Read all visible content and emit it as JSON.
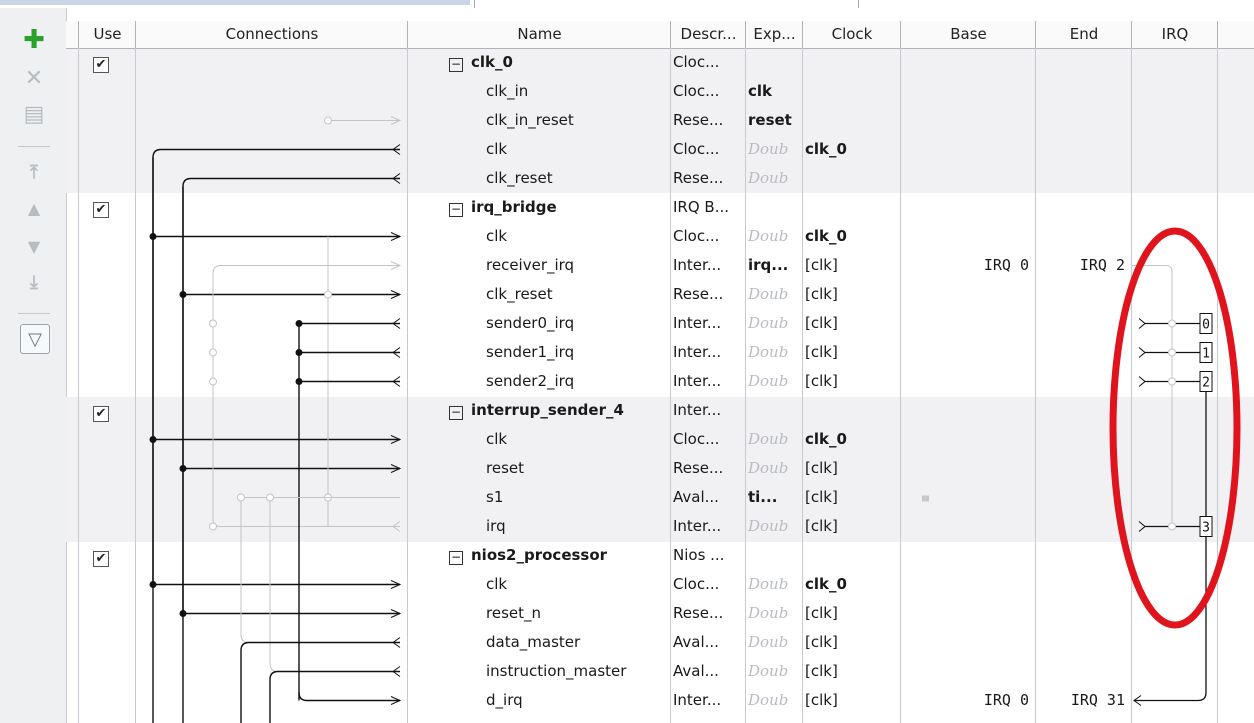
{
  "toolbar": {
    "add": "✚",
    "remove": "✕",
    "edit": "▤",
    "move_top": "⤒",
    "move_up": "▲",
    "move_down": "▼",
    "move_bottom": "⤓",
    "filter": "▽"
  },
  "columns": {
    "use": "Use",
    "connections": "Connections",
    "name": "Name",
    "description": "Descr...",
    "export": "Exp...",
    "clock": "Clock",
    "base": "Base",
    "end": "End",
    "irq": "IRQ"
  },
  "checked_glyph": "✔",
  "collapse_glyph": "−",
  "rows": [
    {
      "name": "clk_0",
      "descr": "Cloc...",
      "exp": "",
      "clock": "",
      "base": "",
      "end": ""
    },
    {
      "name": "clk_in",
      "descr": "Cloc...",
      "exp": "clk",
      "clock": "",
      "base": "",
      "end": ""
    },
    {
      "name": "clk_in_reset",
      "descr": "Rese...",
      "exp": "reset",
      "clock": "",
      "base": "",
      "end": ""
    },
    {
      "name": "clk",
      "descr": "Cloc...",
      "exp": "Doub",
      "clock": "clk_0",
      "base": "",
      "end": ""
    },
    {
      "name": "clk_reset",
      "descr": "Rese...",
      "exp": "Doub",
      "clock": "",
      "base": "",
      "end": ""
    },
    {
      "name": "irq_bridge",
      "descr": "IRQ B...",
      "exp": "",
      "clock": "",
      "base": "",
      "end": ""
    },
    {
      "name": "clk",
      "descr": "Cloc...",
      "exp": "Doub",
      "clock": "clk_0",
      "base": "",
      "end": ""
    },
    {
      "name": "receiver_irq",
      "descr": "Inter...",
      "exp": "irq...",
      "clock": "[clk]",
      "base": "IRQ 0",
      "end": "IRQ 2"
    },
    {
      "name": "clk_reset",
      "descr": "Rese...",
      "exp": "Doub",
      "clock": "[clk]",
      "base": "",
      "end": ""
    },
    {
      "name": "sender0_irq",
      "descr": "Inter...",
      "exp": "Doub",
      "clock": "[clk]",
      "base": "",
      "end": ""
    },
    {
      "name": "sender1_irq",
      "descr": "Inter...",
      "exp": "Doub",
      "clock": "[clk]",
      "base": "",
      "end": ""
    },
    {
      "name": "sender2_irq",
      "descr": "Inter...",
      "exp": "Doub",
      "clock": "[clk]",
      "base": "",
      "end": ""
    },
    {
      "name": "interrup_sender_4",
      "descr": "Inter...",
      "exp": "",
      "clock": "",
      "base": "",
      "end": ""
    },
    {
      "name": "clk",
      "descr": "Cloc...",
      "exp": "Doub",
      "clock": "clk_0",
      "base": "",
      "end": ""
    },
    {
      "name": "reset",
      "descr": "Rese...",
      "exp": "Doub",
      "clock": "[clk]",
      "base": "",
      "end": ""
    },
    {
      "name": "s1",
      "descr": "Aval...",
      "exp": "ti...",
      "clock": "[clk]",
      "base": "",
      "end": ""
    },
    {
      "name": "irq",
      "descr": "Inter...",
      "exp": "Doub",
      "clock": "[clk]",
      "base": "",
      "end": ""
    },
    {
      "name": "nios2_processor",
      "descr": "Nios ...",
      "exp": "",
      "clock": "",
      "base": "",
      "end": ""
    },
    {
      "name": "clk",
      "descr": "Cloc...",
      "exp": "Doub",
      "clock": "clk_0",
      "base": "",
      "end": ""
    },
    {
      "name": "reset_n",
      "descr": "Rese...",
      "exp": "Doub",
      "clock": "[clk]",
      "base": "",
      "end": ""
    },
    {
      "name": "data_master",
      "descr": "Aval...",
      "exp": "Doub",
      "clock": "[clk]",
      "base": "",
      "end": ""
    },
    {
      "name": "instruction_master",
      "descr": "Aval...",
      "exp": "Doub",
      "clock": "[clk]",
      "base": "",
      "end": ""
    },
    {
      "name": "d_irq",
      "descr": "Inter...",
      "exp": "Doub",
      "clock": "[clk]",
      "base": "IRQ 0",
      "end": "IRQ 31"
    }
  ],
  "irq_numbers": [
    "0",
    "1",
    "2",
    "3"
  ],
  "colors": {
    "annotation": "#e0141c",
    "group_bg": "#f1f1f3",
    "add_icon": "#2aa12a"
  }
}
